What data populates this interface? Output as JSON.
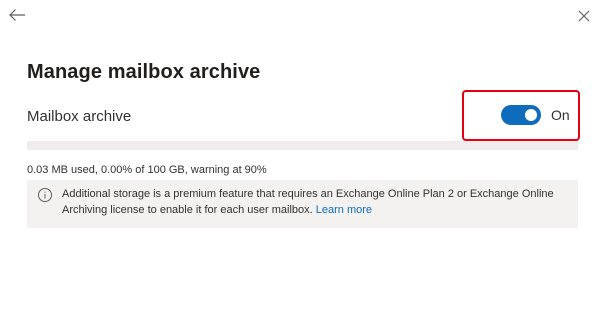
{
  "panel": {
    "title": "Manage mailbox archive"
  },
  "archive": {
    "label": "Mailbox archive",
    "toggle_state": "On",
    "toggle_on": true,
    "usage_text": "0.03 MB used, 0.00% of 100 GB, warning at 90%",
    "usage_fraction": 0.0
  },
  "info": {
    "icon": "info-icon",
    "message": "Additional storage is a premium feature that requires an Exchange Online Plan 2 or Exchange Online Archiving license to enable it for each user mailbox.",
    "link_text": "Learn more"
  },
  "icons": {
    "back": "back-arrow-icon",
    "close": "close-icon"
  },
  "colors": {
    "accent": "#0f6cbd",
    "highlight_border": "#e3000f",
    "info_background": "#f3f2f1"
  }
}
